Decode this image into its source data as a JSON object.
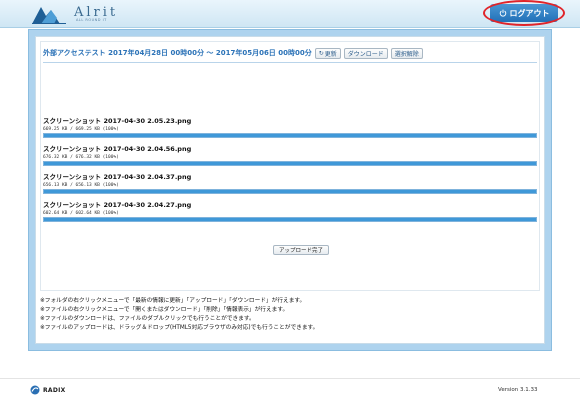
{
  "header": {
    "logo_text": "Alrit",
    "logo_sub": "ALL ROUND IT",
    "logout_label": "ログアウト"
  },
  "toolbar": {
    "title": "外部アクセステスト 2017年04月28日 00時00分 〜 2017年05月06日 00時00分",
    "refresh_label": "更新",
    "download_label": "ダウンロード",
    "deselect_label": "選択解除"
  },
  "files": [
    {
      "name": "スクリーンショット 2017-04-30 2.05.23.png",
      "size": "669.25 KB / 669.25 KB (100%)",
      "progress": 100
    },
    {
      "name": "スクリーンショット 2017-04-30 2.04.56.png",
      "size": "676.32 KB / 676.32 KB (100%)",
      "progress": 100
    },
    {
      "name": "スクリーンショット 2017-04-30 2.04.37.png",
      "size": "656.13 KB / 656.13 KB (100%)",
      "progress": 100
    },
    {
      "name": "スクリーンショット 2017-04-30 2.04.27.png",
      "size": "602.64 KB / 602.64 KB (100%)",
      "progress": 100
    }
  ],
  "upload_done_label": "アップロード完了",
  "notes": [
    "※フォルダの右クリックメニューで「最新の情報に更新」「アップロード」「ダウンロード」が行えます。",
    "※ファイルの右クリックメニューで「開くまたはダウンロード」「削除」「情報表示」が行えます。",
    "※ファイルのダウンロードは、ファイルのダブルクリックでも行うことができます。",
    "※ファイルのアップロードは、ドラッグ＆ドロップ(HTML5対応ブラウザのみ対応)でも行うことができます。"
  ],
  "footer": {
    "brand": "RADIX",
    "version": "Version 3.1.33"
  },
  "colors": {
    "accent": "#2b72b7",
    "frame": "#aed3ee",
    "progress": "#3f98d8",
    "highlight_ring": "#e0242a"
  }
}
